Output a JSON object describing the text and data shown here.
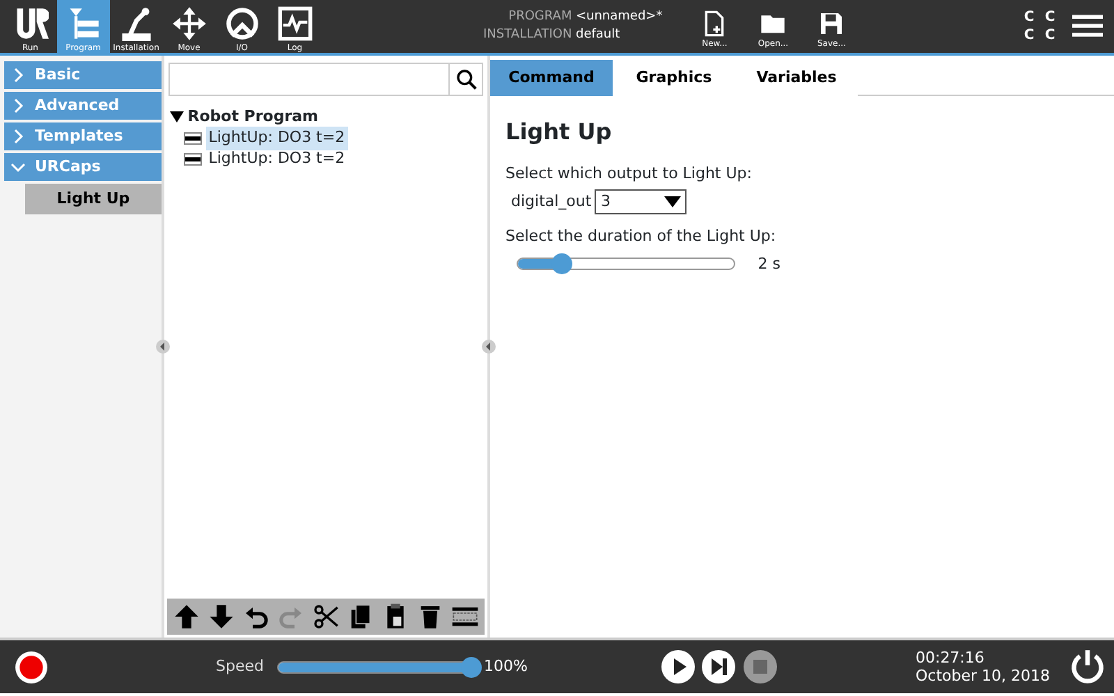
{
  "header": {
    "nav_tabs": [
      {
        "label": "Run",
        "selected": false
      },
      {
        "label": "Program",
        "selected": true
      },
      {
        "label": "Installation",
        "selected": false
      },
      {
        "label": "Move",
        "selected": false
      },
      {
        "label": "I/O",
        "selected": false
      },
      {
        "label": "Log",
        "selected": false
      }
    ],
    "program_label": "PROGRAM",
    "program_value": "<unnamed>*",
    "installation_label": "INSTALLATION",
    "installation_value": "default",
    "file_buttons": [
      "New...",
      "Open...",
      "Save..."
    ],
    "status_letters": [
      "C",
      "C",
      "C",
      "C"
    ]
  },
  "sidebar": {
    "groups": [
      {
        "label": "Basic",
        "expanded": false
      },
      {
        "label": "Advanced",
        "expanded": false
      },
      {
        "label": "Templates",
        "expanded": false
      },
      {
        "label": "URCaps",
        "expanded": true
      }
    ],
    "items": [
      {
        "label": "Light Up",
        "selected": true
      }
    ]
  },
  "tree": {
    "root": "Robot Program",
    "expanded": true,
    "children": [
      {
        "label": "LightUp: DO3 t=2",
        "selected": true
      },
      {
        "label": "LightUp: DO3 t=2",
        "selected": false
      }
    ]
  },
  "toolbar": [
    {
      "kind": "up",
      "disabled": false
    },
    {
      "kind": "down",
      "disabled": false
    },
    {
      "kind": "undo",
      "disabled": false
    },
    {
      "kind": "redo",
      "disabled": true
    },
    {
      "kind": "cut",
      "disabled": false
    },
    {
      "kind": "copy",
      "disabled": false
    },
    {
      "kind": "paste",
      "disabled": false
    },
    {
      "kind": "delete",
      "disabled": false
    },
    {
      "kind": "suppress",
      "disabled": false
    }
  ],
  "tabs": [
    {
      "label": "Command",
      "selected": true
    },
    {
      "label": "Graphics",
      "selected": false
    },
    {
      "label": "Variables",
      "selected": false
    }
  ],
  "command": {
    "title": "Light Up",
    "output_prompt": "Select which output to Light Up:",
    "output_label": "digital_out",
    "output_value": "3",
    "duration_prompt": "Select the duration of the Light Up:",
    "duration_slider": {
      "level": 0.2
    },
    "duration_reading": "2 s"
  },
  "footer": {
    "speed_label": "Speed",
    "speed_slider": {
      "level": 1.0
    },
    "speed_reading": "100%",
    "time": "00:27:16",
    "date": "October 10, 2018"
  }
}
